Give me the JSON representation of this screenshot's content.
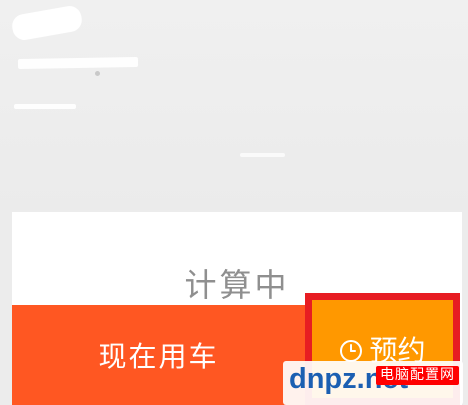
{
  "route_panel": {
    "calculating_text": "计算中"
  },
  "actions": {
    "now_label": "现在用车",
    "reserve_label": "预约"
  },
  "watermark": {
    "site_text": "dnpz.net",
    "badge_text": "电脑配置网"
  }
}
